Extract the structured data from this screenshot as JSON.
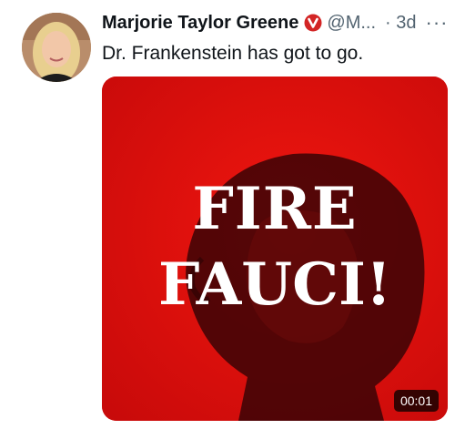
{
  "tweet": {
    "author_name": "Marjorie Taylor Greene",
    "handle": "@M...",
    "timestamp": "· 3d",
    "more": "···",
    "text": "Dr. Frankenstein has got to go.",
    "verified_icon": "red-verified-badge-icon"
  },
  "media": {
    "headline_line1": "FIRE",
    "headline_line2": "FAUCI!",
    "duration": "00:01",
    "background_color": "#e60c0c"
  },
  "colors": {
    "text_primary": "#0f1419",
    "text_secondary": "#536471",
    "badge_red": "#d32525"
  }
}
